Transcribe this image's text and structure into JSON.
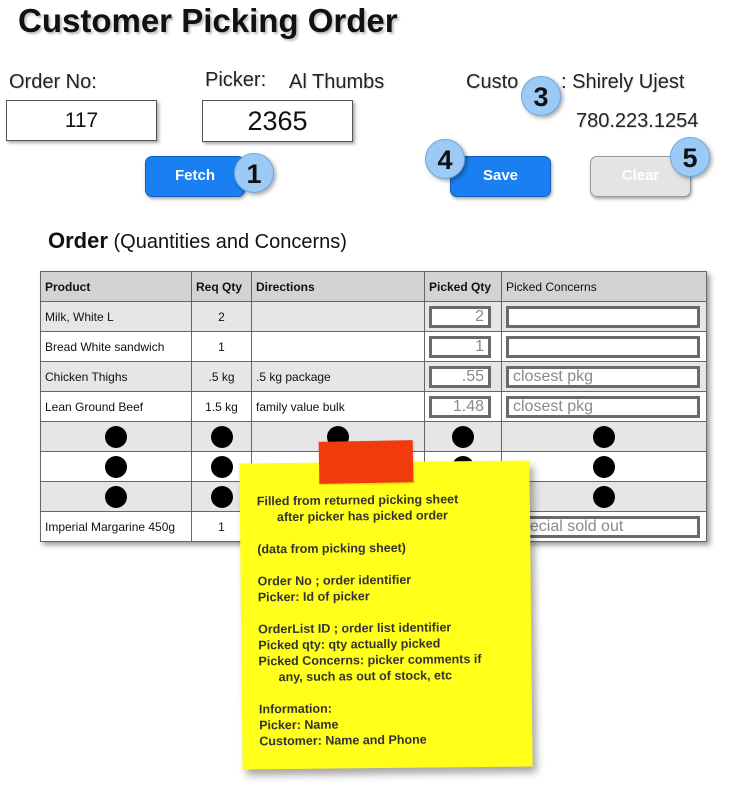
{
  "title": "Customer Picking Order",
  "order_no": {
    "label": "Order No:",
    "value": "117"
  },
  "picker": {
    "label": "Picker:",
    "name": "Al Thumbs",
    "value": "2365"
  },
  "customer": {
    "label_left": "Custo",
    "label_right": ": Shirely Ujest",
    "phone": "780.223.1254"
  },
  "buttons": {
    "fetch": "Fetch",
    "save": "Save",
    "clear": "Clear"
  },
  "badges": [
    "1",
    "2",
    "3",
    "4",
    "5"
  ],
  "order_section": {
    "heading": "Order",
    "subheading": "(Quantities and Concerns)"
  },
  "table": {
    "headers": [
      "Product",
      "Req Qty",
      "Directions",
      "Picked Qty",
      "Picked Concerns"
    ],
    "rows": [
      {
        "product": "Milk, White L",
        "req": "2",
        "dir": "",
        "picked": "2",
        "concern": ""
      },
      {
        "product": "Bread White sandwich",
        "req": "1",
        "dir": "",
        "picked": "1",
        "concern": ""
      },
      {
        "product": "Chicken Thighs",
        "req": ".5 kg",
        "dir": ".5 kg package",
        "picked": ".55",
        "concern": "closest pkg"
      },
      {
        "product": "Lean Ground Beef",
        "req": "1.5 kg",
        "dir": "family value bulk",
        "picked": "1.48",
        "concern": "closest pkg"
      }
    ],
    "last_row": {
      "product": "Imperial Margarine 450g",
      "req": "1",
      "concern": "special sold out"
    }
  },
  "note": {
    "lines": [
      "Filled from returned picking sheet",
      "after  picker has  picked order",
      "",
      "(data from picking sheet)",
      "",
      "Order No ; order identifier",
      "Picker: Id of picker",
      "",
      "OrderList ID ; order list identifier",
      "Picked qty: qty actually picked",
      "Picked Concerns: picker comments if",
      "any, such as out of stock, etc",
      "",
      "Information:",
      "Picker: Name",
      "Customer: Name and Phone"
    ]
  },
  "colors": {
    "primary_button": "#1a7ff0",
    "badge": "#9ccaf6",
    "note": "#ffff1a",
    "tape": "#f23a0c"
  }
}
